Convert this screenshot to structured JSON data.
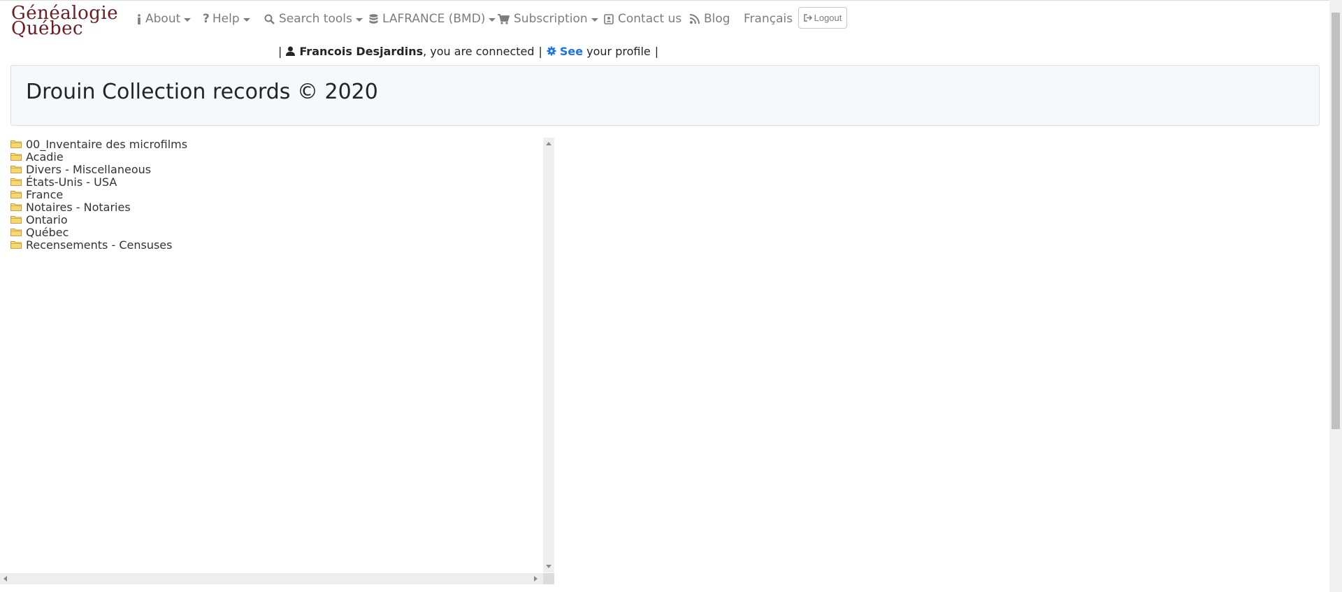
{
  "logo": {
    "line1": "Généalogie",
    "line2": "Québec",
    "color": "#6e1a1e"
  },
  "nav": {
    "about": "About",
    "help": "Help",
    "search_tools": "Search tools",
    "lafrance": "LAFRANCE (BMD)",
    "subscription": "Subscription",
    "contact": "Contact us",
    "blog": "Blog",
    "language": "Français",
    "logout": "Logout"
  },
  "user": {
    "name": "Francois Desjardins",
    "connected_text": ", you are connected",
    "see_label": "See",
    "profile_text": "your profile",
    "separator": "|"
  },
  "page_title": "Drouin Collection records © 2020",
  "tree": {
    "items": [
      "00_Inventaire des microfilms",
      "Acadie",
      "Divers - Miscellaneous",
      "États-Unis - USA",
      "France",
      "Notaires - Notaries",
      "Ontario",
      "Québec",
      "Recensements - Censuses"
    ]
  },
  "colors": {
    "link": "#1a73e8",
    "nav_text": "#7d7d7d",
    "folder": "#f0c040"
  }
}
